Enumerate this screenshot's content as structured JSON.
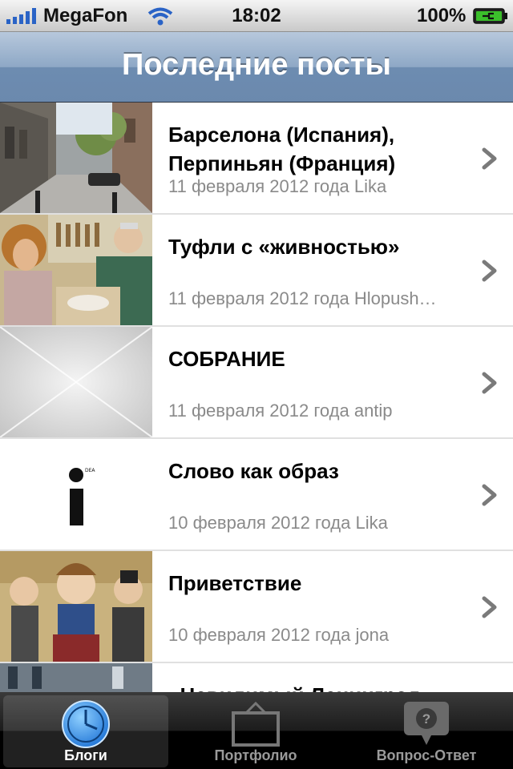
{
  "status_bar": {
    "carrier": "MegaFon",
    "time": "18:02",
    "battery": "100%"
  },
  "nav": {
    "title": "Последние посты"
  },
  "posts": [
    {
      "title": "Барселона (Испания), Перпиньян (Франция)",
      "meta": "11 февраля 2012 года Lika",
      "thumbnail": "street-photo"
    },
    {
      "title": "Туфли с «живностью»",
      "meta": "11 февраля 2012 года Hlopush…",
      "thumbnail": "workshop-photo"
    },
    {
      "title": "СОБРАНИЕ",
      "meta": "11 февраля 2012 года antip",
      "thumbnail": "placeholder-image"
    },
    {
      "title": "Слово как образ",
      "meta": "10 февраля 2012 года Lika",
      "thumbnail": "idea-logo",
      "logo_text": "DEA"
    },
    {
      "title": "Приветствие",
      "meta": "10 февраля 2012 года jona",
      "thumbnail": "dolls-photo"
    },
    {
      "title": "«Невидимый Ленинград»",
      "meta": "",
      "thumbnail": "building-photo"
    }
  ],
  "tab_bar": {
    "tabs": [
      {
        "label": "Блоги",
        "icon": "clock-icon",
        "active": true
      },
      {
        "label": "Портфолио",
        "icon": "picture-frame-icon",
        "active": false
      },
      {
        "label": "Вопрос-Ответ",
        "icon": "question-bubble-icon",
        "active": false
      }
    ]
  },
  "colors": {
    "nav_blue": "#6d8cb1",
    "meta_gray": "#8a8a8a",
    "tab_active": "#ffffff"
  }
}
